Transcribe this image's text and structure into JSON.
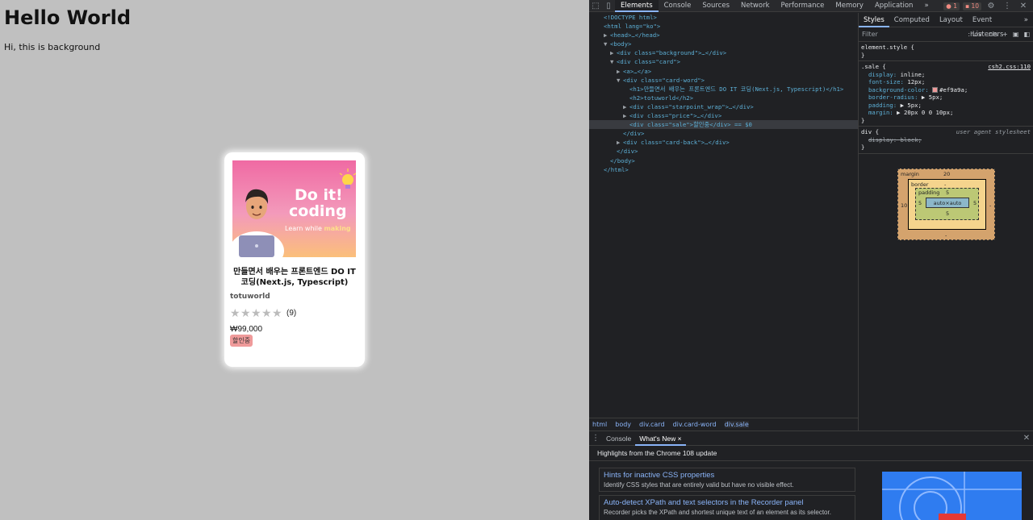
{
  "page": {
    "heading": "Hello World",
    "paragraph": "Hi, this is background"
  },
  "card": {
    "image_text_line1": "Do it!",
    "image_text_line2": "coding",
    "image_text_line3_a": "Learn while",
    "image_text_line3_b": "making",
    "title": "만들면서 배우는 프론트엔드 DO IT 코딩(Next.js, Typescript)",
    "author": "totuworld",
    "rating_count": "(9)",
    "star_rating": 0,
    "price": "₩99,000",
    "sale_label": "할인중"
  },
  "devtools": {
    "tabs": [
      "Elements",
      "Console",
      "Sources",
      "Network",
      "Performance",
      "Memory",
      "Application"
    ],
    "more_tabs": "»",
    "error_count": "1",
    "warning_count": "10",
    "dom_lines": [
      {
        "indent": 0,
        "tri": "",
        "html": "<!DOCTYPE html>"
      },
      {
        "indent": 0,
        "tri": "",
        "html": "<html lang=\"ko\">"
      },
      {
        "indent": 1,
        "tri": "▶",
        "html": "<head>…</head>"
      },
      {
        "indent": 1,
        "tri": "▼",
        "html": "<body>"
      },
      {
        "indent": 2,
        "tri": "▶",
        "html": "<div class=\"background\">…</div>"
      },
      {
        "indent": 2,
        "tri": "▼",
        "html": "<div class=\"card\">"
      },
      {
        "indent": 3,
        "tri": "▶",
        "html": "<a>…</a>"
      },
      {
        "indent": 3,
        "tri": "▼",
        "html": "<div class=\"card-word\">"
      },
      {
        "indent": 4,
        "tri": "",
        "html": "<h1>만들면서 배우는 프론트엔드 DO IT 코딩(Next.js, Typescript)</h1>"
      },
      {
        "indent": 4,
        "tri": "",
        "html": "<h2>totuworld</h2>"
      },
      {
        "indent": 4,
        "tri": "▶",
        "html": "<div class=\"starpoint_wrap\">…</div>"
      },
      {
        "indent": 4,
        "tri": "▶",
        "html": "<div class=\"price\">…</div>"
      },
      {
        "indent": 4,
        "tri": "",
        "html": "<div class=\"sale\">할인중</div> == $0",
        "selected": true
      },
      {
        "indent": 3,
        "tri": "",
        "html": "</div>"
      },
      {
        "indent": 3,
        "tri": "▶",
        "html": "<div class=\"card-back\">…</div>"
      },
      {
        "indent": 2,
        "tri": "",
        "html": "</div>"
      },
      {
        "indent": 1,
        "tri": "",
        "html": "</body>"
      },
      {
        "indent": 0,
        "tri": "",
        "html": "</html>"
      }
    ],
    "breadcrumbs": [
      "html",
      "body",
      "div.card",
      "div.card-word",
      "div.sale"
    ],
    "styles_tabs": [
      "Styles",
      "Computed",
      "Layout",
      "Event Listeners"
    ],
    "filter_placeholder": "Filter",
    "filter_hov": ":hov",
    "filter_cls": ".cls",
    "element_style": "element.style {",
    "sale_rule": {
      "selector": ".sale {",
      "source": "csh2.css:110",
      "props": [
        [
          "display",
          "inline;"
        ],
        [
          "font-size",
          "12px;"
        ],
        [
          "background-color",
          "#ef9a9a;"
        ],
        [
          "border-radius",
          "▶ 5px;"
        ],
        [
          "padding",
          "▶ 5px;"
        ],
        [
          "margin",
          "▶ 20px 0 0 10px;"
        ]
      ]
    },
    "div_rule": {
      "selector": "div {",
      "source": "user agent stylesheet",
      "prop": "display: block;"
    },
    "box_model": {
      "margin_label": "margin",
      "margin_top": "20",
      "margin_left": "10",
      "margin_right": "-",
      "margin_bottom": "-",
      "border_label": "border",
      "border_value": "-",
      "padding_label": "padding",
      "padding_value": "5",
      "content": "auto×auto"
    },
    "drawer_tabs": [
      "Console",
      "What's New"
    ],
    "drawer_heading": "Highlights from the Chrome 108 update",
    "drawer_items": [
      {
        "title": "Hints for inactive CSS properties",
        "desc": "Identify CSS styles that are entirely valid but have no visible effect."
      },
      {
        "title": "Auto-detect XPath and text selectors in the Recorder panel",
        "desc": "Recorder picks the XPath and shortest unique text of an element as its selector."
      }
    ],
    "accent": "#8ab4f8",
    "sale_color": "#ef9a9a"
  }
}
